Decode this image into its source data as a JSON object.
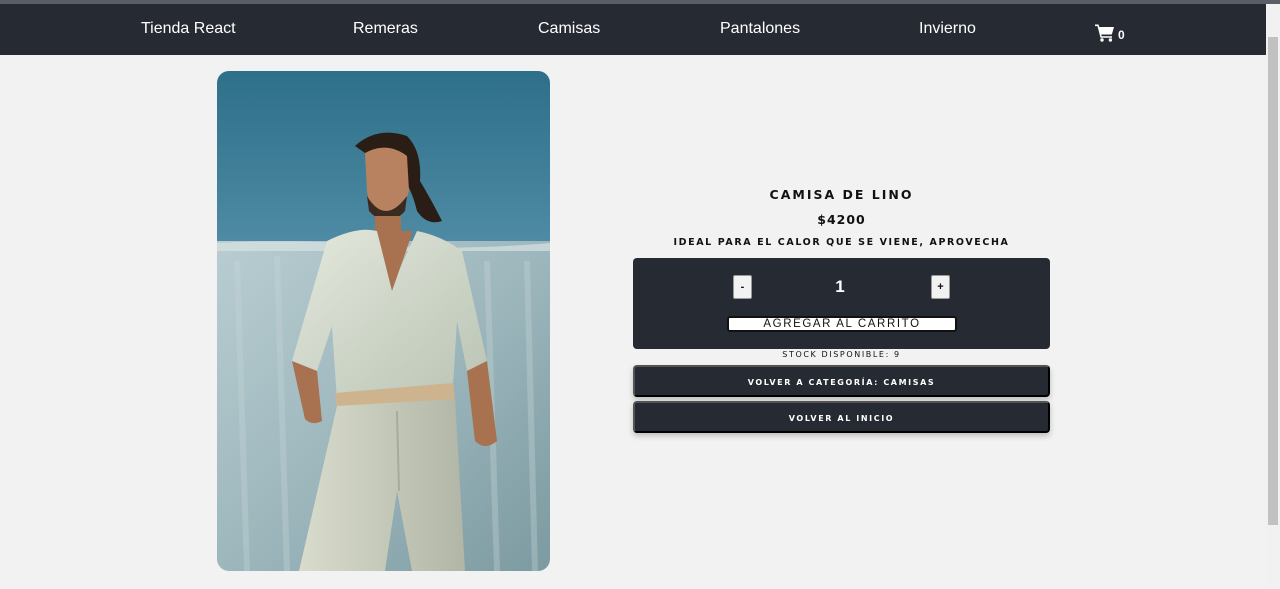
{
  "navbar": {
    "brand": "Tienda React",
    "links": [
      "Remeras",
      "Camisas",
      "Pantalones",
      "Invierno"
    ],
    "cart_count": "0",
    "cart_icon": "shopping-cart-icon"
  },
  "product": {
    "title": "CAMISA DE LINO",
    "price": "$4200",
    "description": "IDEAL PARA EL CALOR QUE SE VIENE, APROVECHA",
    "quantity": "1",
    "decrement_label": "-",
    "increment_label": "+",
    "add_to_cart_label": "AGREGAR AL CARRITO",
    "stock_text": "STOCK DISPONIBLE: 9",
    "back_category_label": "VOLVER A CATEGORÍA: CAMISAS",
    "back_home_label": "VOLVER AL INICIO"
  },
  "colors": {
    "navbar_bg": "#262a33",
    "page_bg": "#f1f2f1",
    "button_bg": "#262a33",
    "text_light": "#ffffff"
  }
}
